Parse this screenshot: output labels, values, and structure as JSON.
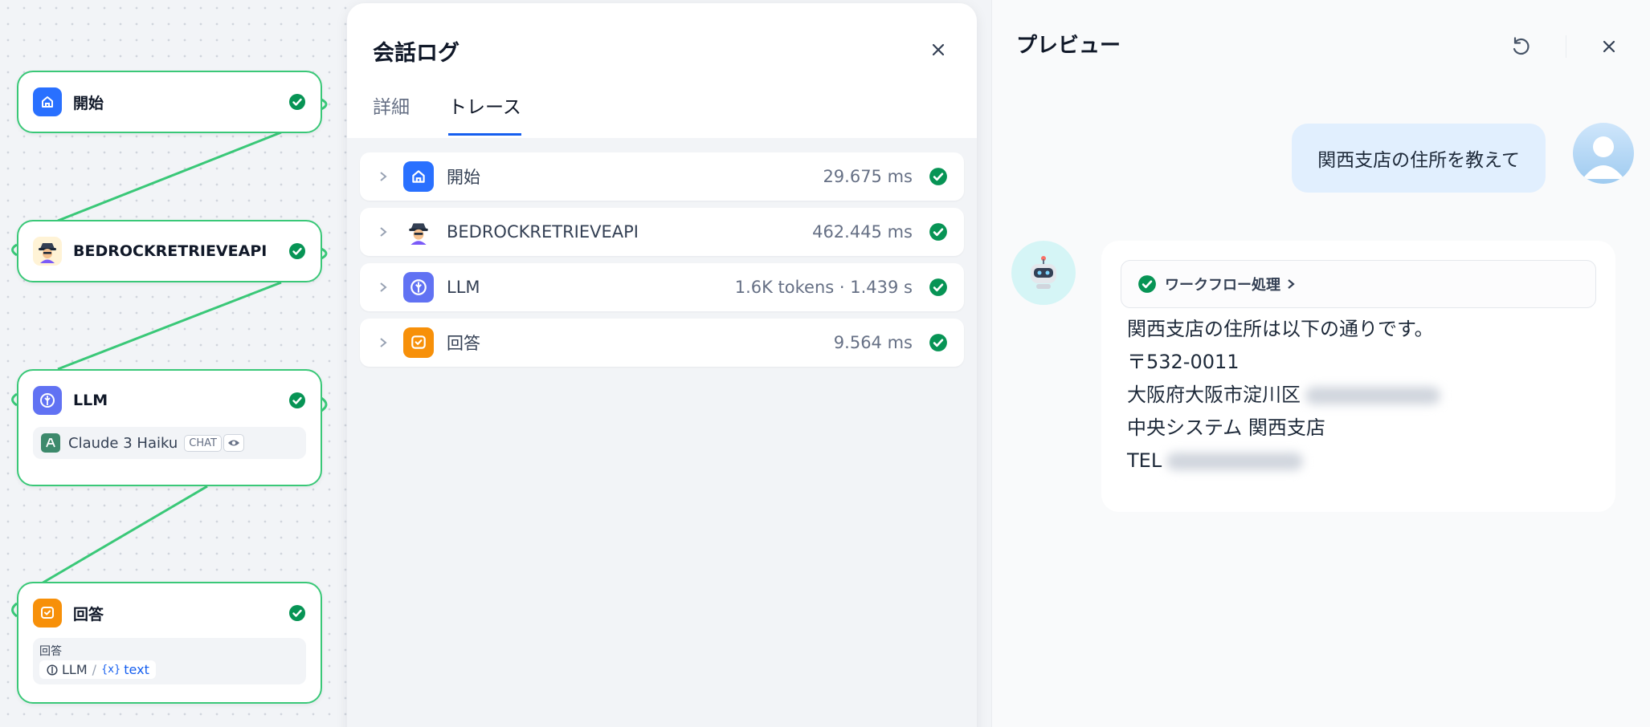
{
  "canvas": {
    "nodes": [
      {
        "id": "start",
        "title": "開始",
        "icon": "home-icon",
        "color": "#2970ff"
      },
      {
        "id": "bedrock",
        "title": "BEDROCKRETRIEVEAPI",
        "icon": "detective-icon",
        "color": "#fff3d6"
      },
      {
        "id": "llm",
        "title": "LLM",
        "icon": "llm-icon",
        "color": "#6172f3",
        "model": "Claude 3 Haiku",
        "model_badge": "CHAT"
      },
      {
        "id": "answer",
        "title": "回答",
        "icon": "answer-icon",
        "color": "#f79009",
        "field_label": "回答",
        "var_source": "LLM",
        "var_separator": "/",
        "var_name": "text",
        "var_prefix": "{x}"
      }
    ],
    "accent": "#3ac878"
  },
  "log_panel": {
    "title": "会話ログ",
    "tabs": [
      {
        "label": "詳細",
        "active": false
      },
      {
        "label": "トレース",
        "active": true
      }
    ],
    "trace": [
      {
        "name": "開始",
        "icon": "home-icon",
        "metric": "29.675 ms",
        "status": "success"
      },
      {
        "name": "BEDROCKRETRIEVEAPI",
        "icon": "detective-icon",
        "metric": "462.445 ms",
        "status": "success"
      },
      {
        "name": "LLM",
        "icon": "llm-icon",
        "metric": "1.6K tokens · 1.439 s",
        "status": "success"
      },
      {
        "name": "回答",
        "icon": "answer-icon",
        "metric": "9.564 ms",
        "status": "success"
      }
    ]
  },
  "preview": {
    "title": "プレビュー",
    "user_message": "関西支店の住所を教えて",
    "workflow_label": "ワークフロー処理",
    "answer_lines": [
      "関西支店の住所は以下の通りです。",
      "〒532-0011",
      "大阪府大阪市淀川区",
      "中央システム 関西支店",
      "TEL"
    ]
  },
  "colors": {
    "success": "#079455",
    "primary": "#155eef",
    "edge": "#3ac878"
  }
}
